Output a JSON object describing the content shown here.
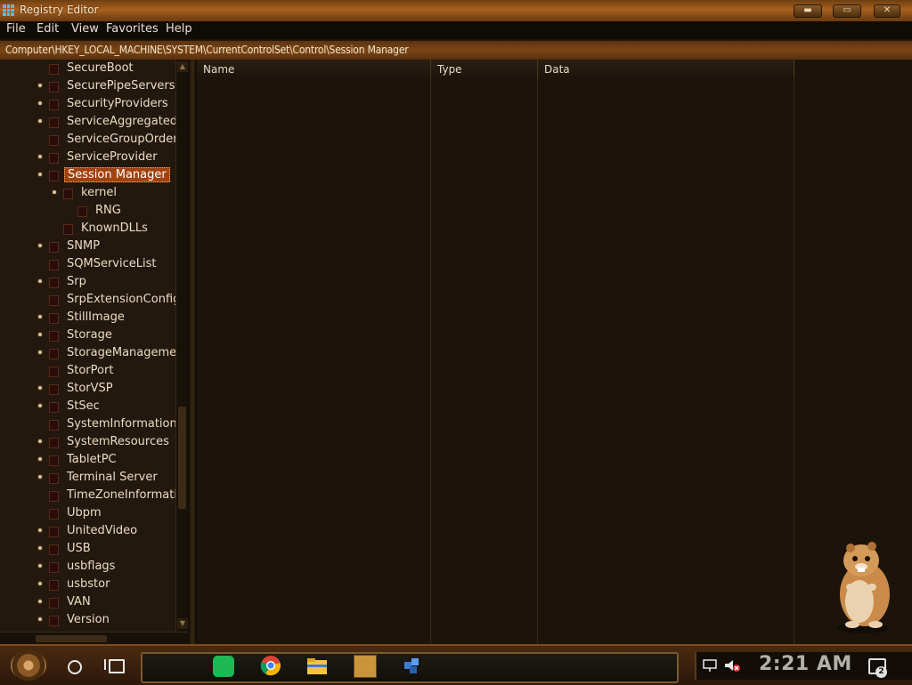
{
  "window": {
    "title": "Registry Editor",
    "controls": {
      "minimize": "▬",
      "maximize": "▭",
      "close": "✕"
    }
  },
  "menu": [
    {
      "label": "File"
    },
    {
      "label": "Edit"
    },
    {
      "label": "View"
    },
    {
      "label": "Favorites"
    },
    {
      "label": "Help"
    }
  ],
  "address": {
    "path": "Computer\\HKEY_LOCAL_MACHINE\\SYSTEM\\CurrentControlSet\\Control\\Session Manager"
  },
  "tree": {
    "selected": "Session Manager",
    "items": [
      {
        "label": "SecureBoot",
        "level": 0,
        "expandable": false
      },
      {
        "label": "SecurePipeServers",
        "level": 0,
        "expandable": true
      },
      {
        "label": "SecurityProviders",
        "level": 0,
        "expandable": true
      },
      {
        "label": "ServiceAggregatedEv",
        "level": 0,
        "expandable": true
      },
      {
        "label": "ServiceGroupOrder",
        "level": 0,
        "expandable": false
      },
      {
        "label": "ServiceProvider",
        "level": 0,
        "expandable": true
      },
      {
        "label": "Session Manager",
        "level": 0,
        "expandable": true,
        "expanded": true,
        "selected": true
      },
      {
        "label": "kernel",
        "level": 1,
        "expandable": true,
        "expanded": true
      },
      {
        "label": "RNG",
        "level": 2,
        "expandable": false
      },
      {
        "label": "KnownDLLs",
        "level": 1,
        "expandable": false
      },
      {
        "label": "SNMP",
        "level": 0,
        "expandable": true
      },
      {
        "label": "SQMServiceList",
        "level": 0,
        "expandable": false
      },
      {
        "label": "Srp",
        "level": 0,
        "expandable": true
      },
      {
        "label": "SrpExtensionConfig",
        "level": 0,
        "expandable": false
      },
      {
        "label": "StillImage",
        "level": 0,
        "expandable": true
      },
      {
        "label": "Storage",
        "level": 0,
        "expandable": true
      },
      {
        "label": "StorageManagement",
        "level": 0,
        "expandable": true
      },
      {
        "label": "StorPort",
        "level": 0,
        "expandable": false
      },
      {
        "label": "StorVSP",
        "level": 0,
        "expandable": true
      },
      {
        "label": "StSec",
        "level": 0,
        "expandable": true
      },
      {
        "label": "SystemInformation",
        "level": 0,
        "expandable": false
      },
      {
        "label": "SystemResources",
        "level": 0,
        "expandable": true
      },
      {
        "label": "TabletPC",
        "level": 0,
        "expandable": true
      },
      {
        "label": "Terminal Server",
        "level": 0,
        "expandable": true
      },
      {
        "label": "TimeZoneInformation",
        "level": 0,
        "expandable": false
      },
      {
        "label": "Ubpm",
        "level": 0,
        "expandable": false
      },
      {
        "label": "UnitedVideo",
        "level": 0,
        "expandable": true
      },
      {
        "label": "USB",
        "level": 0,
        "expandable": true
      },
      {
        "label": "usbflags",
        "level": 0,
        "expandable": true
      },
      {
        "label": "usbstor",
        "level": 0,
        "expandable": true
      },
      {
        "label": "VAN",
        "level": 0,
        "expandable": true
      },
      {
        "label": "Version",
        "level": 0,
        "expandable": true
      }
    ]
  },
  "list": {
    "columns": [
      {
        "label": "Name"
      },
      {
        "label": "Type"
      },
      {
        "label": "Data"
      }
    ],
    "rows": []
  },
  "taskbar": {
    "apps": [
      {
        "name": "spotify-icon",
        "color": "#1db954"
      },
      {
        "name": "chrome-icon",
        "color": "#e53935"
      },
      {
        "name": "file-explorer-icon",
        "color": "#f6c344"
      },
      {
        "name": "game-box-icon",
        "color": "#c8953a"
      },
      {
        "name": "blue-cubes-icon",
        "color": "#3a7bd5"
      }
    ],
    "clock": "2:21 AM",
    "notification_count": "2"
  },
  "theme": {
    "accent": "#a0420f",
    "titlebar": "#a8601c",
    "background": "#1c140b"
  }
}
